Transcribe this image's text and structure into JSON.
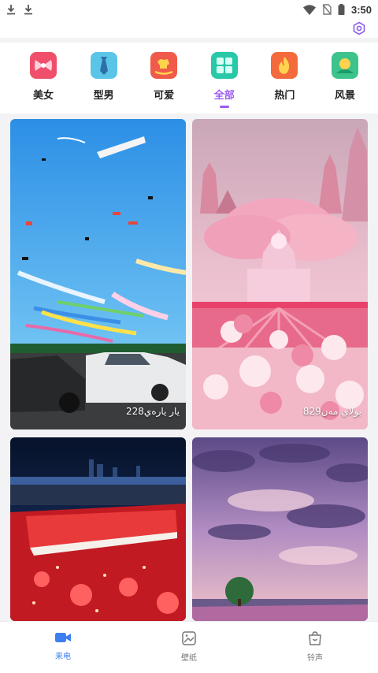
{
  "status_bar": {
    "time": "3:50",
    "left_icons": [
      "download-icon",
      "download-icon"
    ],
    "right_icons": [
      "wifi-icon",
      "no-sim-icon",
      "battery-icon"
    ]
  },
  "categories": [
    {
      "label": "美女",
      "icon": "bow-icon",
      "color": "#f04f6b",
      "active": false
    },
    {
      "label": "型男",
      "icon": "tie-icon",
      "color": "#5bc5e8",
      "active": false
    },
    {
      "label": "可爱",
      "icon": "rocking-horse-icon",
      "color": "#f05a4a",
      "active": false
    },
    {
      "label": "全部",
      "icon": "grid-icon",
      "color": "#28c8a8",
      "active": true
    },
    {
      "label": "热门",
      "icon": "flame-icon",
      "color": "#f46a3c",
      "active": false
    },
    {
      "label": "风景",
      "icon": "landscape-icon",
      "color": "#3dc48c",
      "active": false
    }
  ],
  "cards": [
    {
      "caption": "يار يارەي228",
      "scene": "kites"
    },
    {
      "caption": "بولاي مەن829",
      "scene": "pink-castle"
    },
    {
      "caption": "",
      "scene": "rose-lights"
    },
    {
      "caption": "",
      "scene": "purple-sky"
    }
  ],
  "bottom_nav": [
    {
      "label": "来电",
      "icon": "video-call-icon",
      "active": true
    },
    {
      "label": "壁纸",
      "icon": "wallpaper-icon",
      "active": false
    },
    {
      "label": "铃声",
      "icon": "ringtone-bag-icon",
      "active": false
    }
  ],
  "colors": {
    "accent": "#9b5cf0",
    "nav_active": "#3d7ff0"
  }
}
